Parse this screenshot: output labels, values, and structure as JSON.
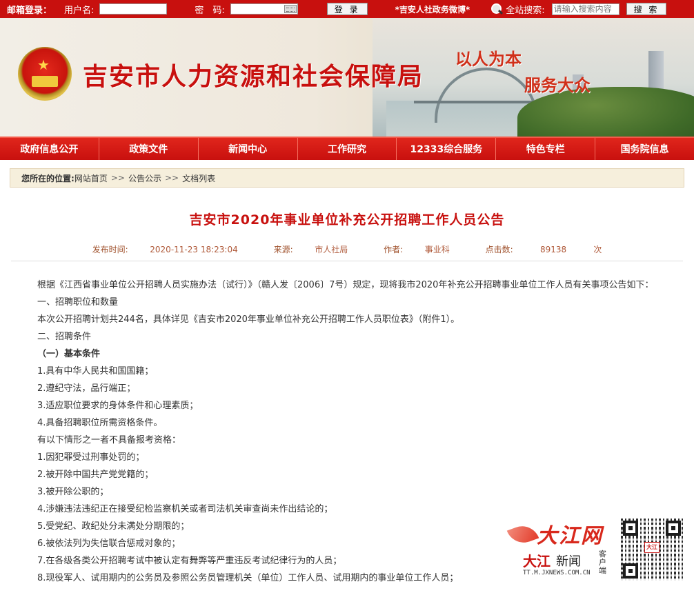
{
  "topbar": {
    "mail_login_label": "邮箱登录：",
    "username_label": "用户名:",
    "password_label": "密　码:",
    "login_button": "登 录",
    "weibo_link": "*吉安人社政务微博*",
    "site_search_label": "全站搜索:",
    "search_placeholder": "请输入搜索内容",
    "search_button": "搜 索"
  },
  "banner": {
    "site_title": "吉安市人力资源和社会保障局",
    "slogan_1": "以人为本",
    "slogan_2": "服务大众"
  },
  "nav": {
    "items": [
      "政府信息公开",
      "政策文件",
      "新闻中心",
      "工作研究",
      "12333综合服务",
      "特色专栏",
      "国务院信息"
    ]
  },
  "breadcrumb": {
    "label": "您所在的位置:",
    "items": [
      "网站首页",
      "公告公示",
      "文档列表"
    ],
    "sep": ">>"
  },
  "article": {
    "title": "吉安市2020年事业单位补充公开招聘工作人员公告",
    "meta": {
      "published_label": "发布时间:",
      "published": "2020-11-23 18:23:04",
      "source_label": "来源:",
      "source": "市人社局",
      "author_label": "作者:",
      "author": "事业科",
      "hits_label": "点击数:",
      "hits": "89138",
      "hits_unit": "次"
    },
    "paragraphs": [
      "根据《江西省事业单位公开招聘人员实施办法（试行）》（赣人发〔2006〕7号）规定，现将我市2020年补充公开招聘事业单位工作人员有关事项公告如下：",
      "一、招聘职位和数量",
      "本次公开招聘计划共244名，具体详见《吉安市2020年事业单位补充公开招聘工作人员职位表》（附件1）。",
      "二、招聘条件",
      "（一）基本条件",
      "1.具有中华人民共和国国籍；",
      "2.遵纪守法，品行端正；",
      "3.适应职位要求的身体条件和心理素质；",
      "4.具备招聘职位所需资格条件。",
      "有以下情形之一者不具备报考资格：",
      "1.因犯罪受过刑事处罚的；",
      "2.被开除中国共产党党籍的；",
      "3.被开除公职的；",
      "4.涉嫌违法违纪正在接受纪检监察机关或者司法机关审查尚未作出结论的；",
      "5.受党纪、政纪处分未满处分期限的；",
      "6.被依法列为失信联合惩戒对象的；",
      "7.在各级各类公开招聘考试中被认定有舞弊等严重违反考试纪律行为的人员；",
      "8.现役军人、试用期内的公务员及参照公务员管理机关（单位）工作人员、试用期内的事业单位工作人员；"
    ]
  },
  "footer_logo": {
    "brand": "大江网",
    "news": "大江",
    "news_suffix": "新闻",
    "url": "TT.M.JXNEWS.COM.CN",
    "client": "客户端",
    "qr_mark": "大江"
  },
  "colors": {
    "primary_red": "#c8100e",
    "breadcrumb_bg": "#f6efdc"
  }
}
